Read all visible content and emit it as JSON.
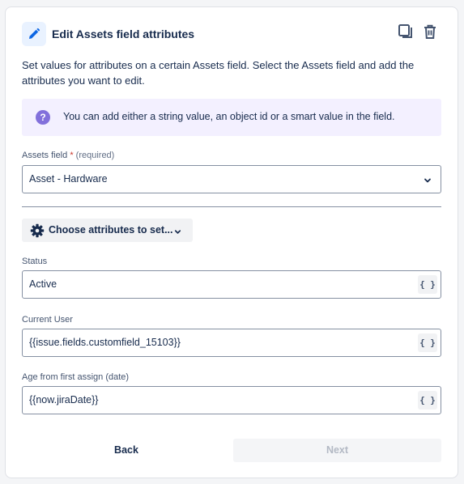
{
  "header": {
    "title": "Edit Assets field attributes",
    "icons": {
      "edit": "pencil-icon",
      "duplicate": "duplicate-icon",
      "delete": "trash-icon"
    }
  },
  "description": "Set values for attributes on a certain Assets field. Select the Assets field and add the attributes you want to edit.",
  "info_banner": {
    "icon": "question-circle-icon",
    "icon_glyph": "?",
    "text": "You can add either a string value, an object id or a smart value in the field."
  },
  "assets_field": {
    "label": "Assets field",
    "required_marker": "*",
    "required_text": "(required)",
    "value": "Asset - Hardware"
  },
  "choose_attributes": {
    "label": "Choose attributes to set...",
    "icon": "gear-icon"
  },
  "attributes": [
    {
      "label": "Status",
      "value": "Active",
      "smart_value_button": "{ }"
    },
    {
      "label": "Current User",
      "value": "{{issue.fields.customfield_15103}}",
      "smart_value_button": "{ }"
    },
    {
      "label": "Age from first assign (date)",
      "value": "{{now.jiraDate}}",
      "smart_value_button": "{ }"
    }
  ],
  "footer": {
    "back_label": "Back",
    "next_label": "Next"
  },
  "colors": {
    "accent": "#0c66e4",
    "info_bg": "#f3f0ff",
    "info_icon": "#8270db",
    "border": "#8590a2"
  }
}
